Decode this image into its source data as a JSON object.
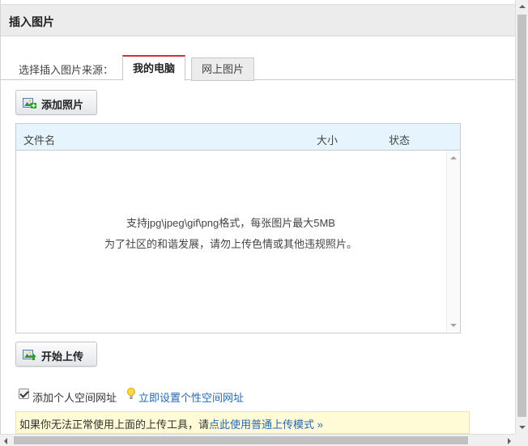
{
  "dialog": {
    "title": "插入图片"
  },
  "source": {
    "label": "选择插入图片来源：",
    "tabs": [
      {
        "label": "我的电脑",
        "active": true
      },
      {
        "label": "网上图片",
        "active": false
      }
    ]
  },
  "buttons": {
    "add_photo": "添加照片",
    "start_upload": "开始上传"
  },
  "file_list": {
    "columns": [
      "文件名",
      "大小",
      "状态"
    ],
    "hint_line1": "支持jpg\\jpeg\\gif\\png格式，每张图片最大5MB",
    "hint_line2": "为了社区的和谐发展，请勿上传色情或其他违规照片。"
  },
  "options": {
    "add_space_url_label": "添加个人空间网址",
    "add_space_url_checked": true,
    "set_space_url_link": "立即设置个性空间网址"
  },
  "notice": {
    "text": "如果你无法正常使用上面的上传工具，请",
    "link": "点此使用普通上传模式 »"
  },
  "colors": {
    "active_tab_accent": "#cc3333",
    "link": "#2668b1",
    "list_header_bg": "#e5f4fd",
    "notice_bg": "#fffbd7"
  }
}
